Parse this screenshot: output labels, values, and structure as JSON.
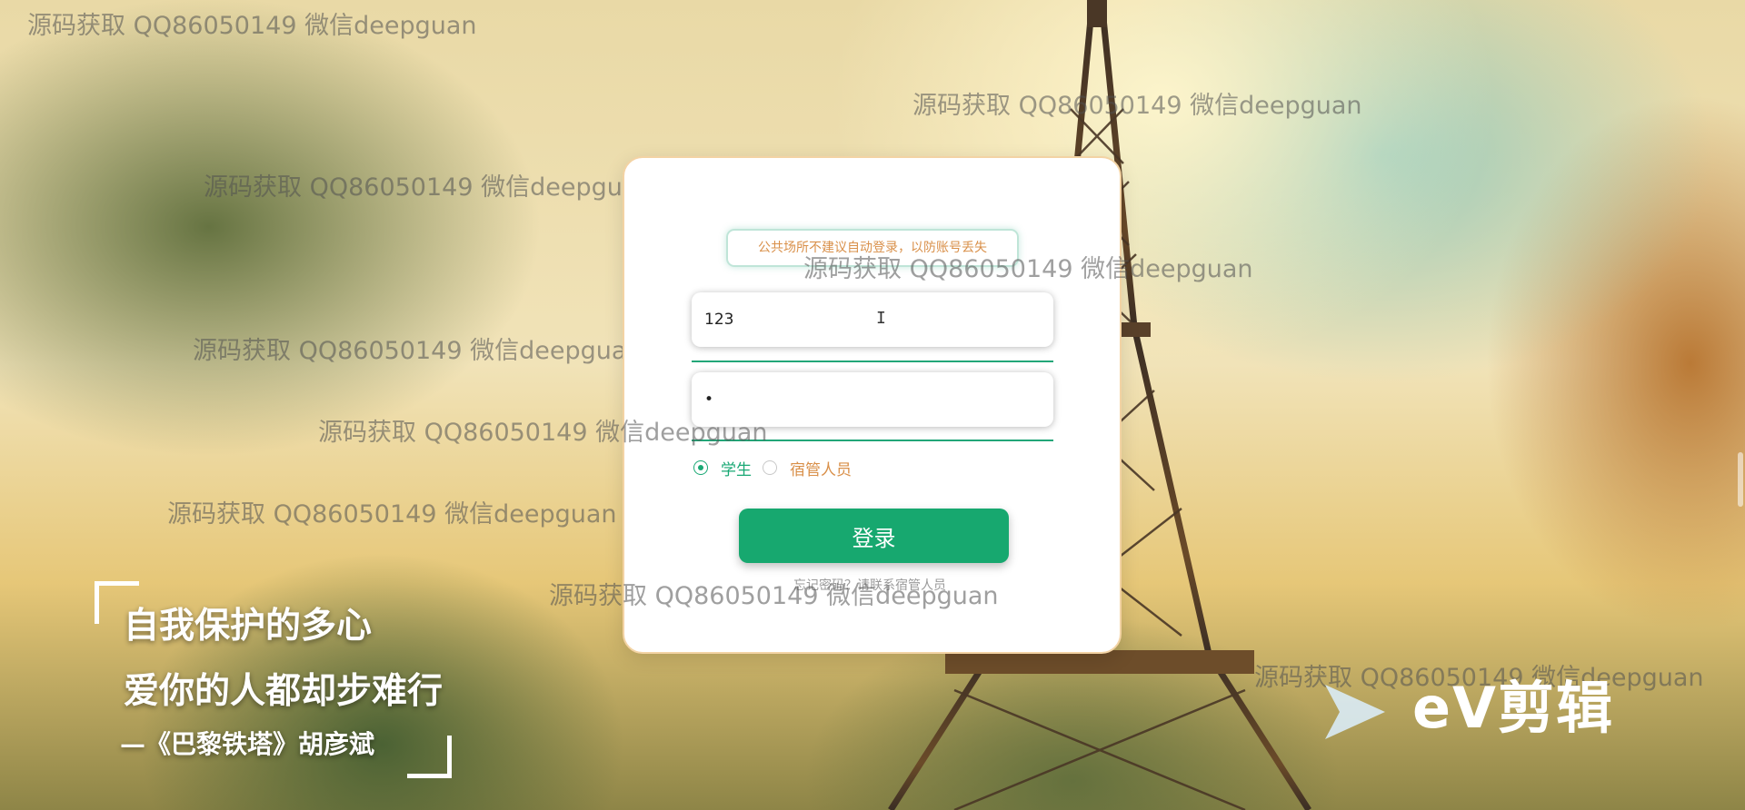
{
  "login": {
    "tip": "公共场所不建议自动登录，以防账号丢失",
    "username_value": "123",
    "password_value": "•",
    "roles": [
      "学生",
      "宿管人员"
    ],
    "selected_role": "学生",
    "login_label": "登录",
    "note": "忘记密码？请联系宿管人员"
  },
  "watermark": "源码获取 QQ86050149 微信deepguan",
  "poem": {
    "line1": "自我保护的多心",
    "line2": "爱你的人都却步难行",
    "line3": "—《巴黎铁塔》胡彦斌"
  },
  "brand": {
    "logo_text": "eV剪辑"
  },
  "colors": {
    "accent": "#17a86f",
    "tip_text": "#d9904a",
    "card_border": "#f3d3a4"
  }
}
